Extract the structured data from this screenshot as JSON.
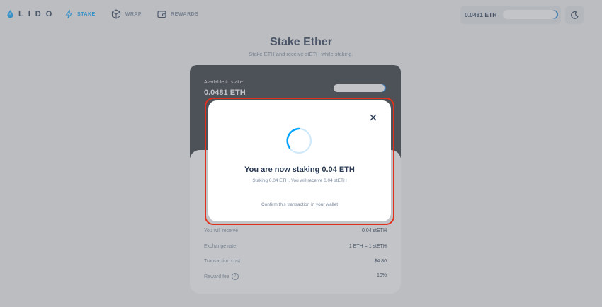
{
  "header": {
    "logo_text": "LIDO",
    "nav": [
      {
        "label": "STAKE",
        "icon": "lightning-icon",
        "active": true
      },
      {
        "label": "WRAP",
        "icon": "cube-icon",
        "active": false
      },
      {
        "label": "REWARDS",
        "icon": "wallet-icon",
        "active": false
      }
    ],
    "wallet_balance": "0.0481 ETH",
    "theme_icon": "moon-icon"
  },
  "main": {
    "title": "Stake Ether",
    "subtitle": "Stake ETH and receive stETH while staking.",
    "available_label": "Available to stake",
    "available_value": "0.0481 ETH"
  },
  "details": [
    {
      "label": "You will receive",
      "value": "0.04 stETH"
    },
    {
      "label": "Exchange rate",
      "value": "1 ETH = 1 stETH"
    },
    {
      "label": "Transaction cost",
      "value": "$4.80"
    },
    {
      "label": "Reward fee",
      "value": "10%"
    }
  ],
  "modal": {
    "title": "You are now staking 0.04 ETH",
    "description": "Staking 0.04 ETH. You will receive 0.04 stETH",
    "footer": "Confirm this transaction in your wallet",
    "close_icon": "close-icon"
  },
  "colors": {
    "accent": "#00a3ff",
    "highlight": "#e0301e",
    "dark_card": "#2a2f36"
  }
}
